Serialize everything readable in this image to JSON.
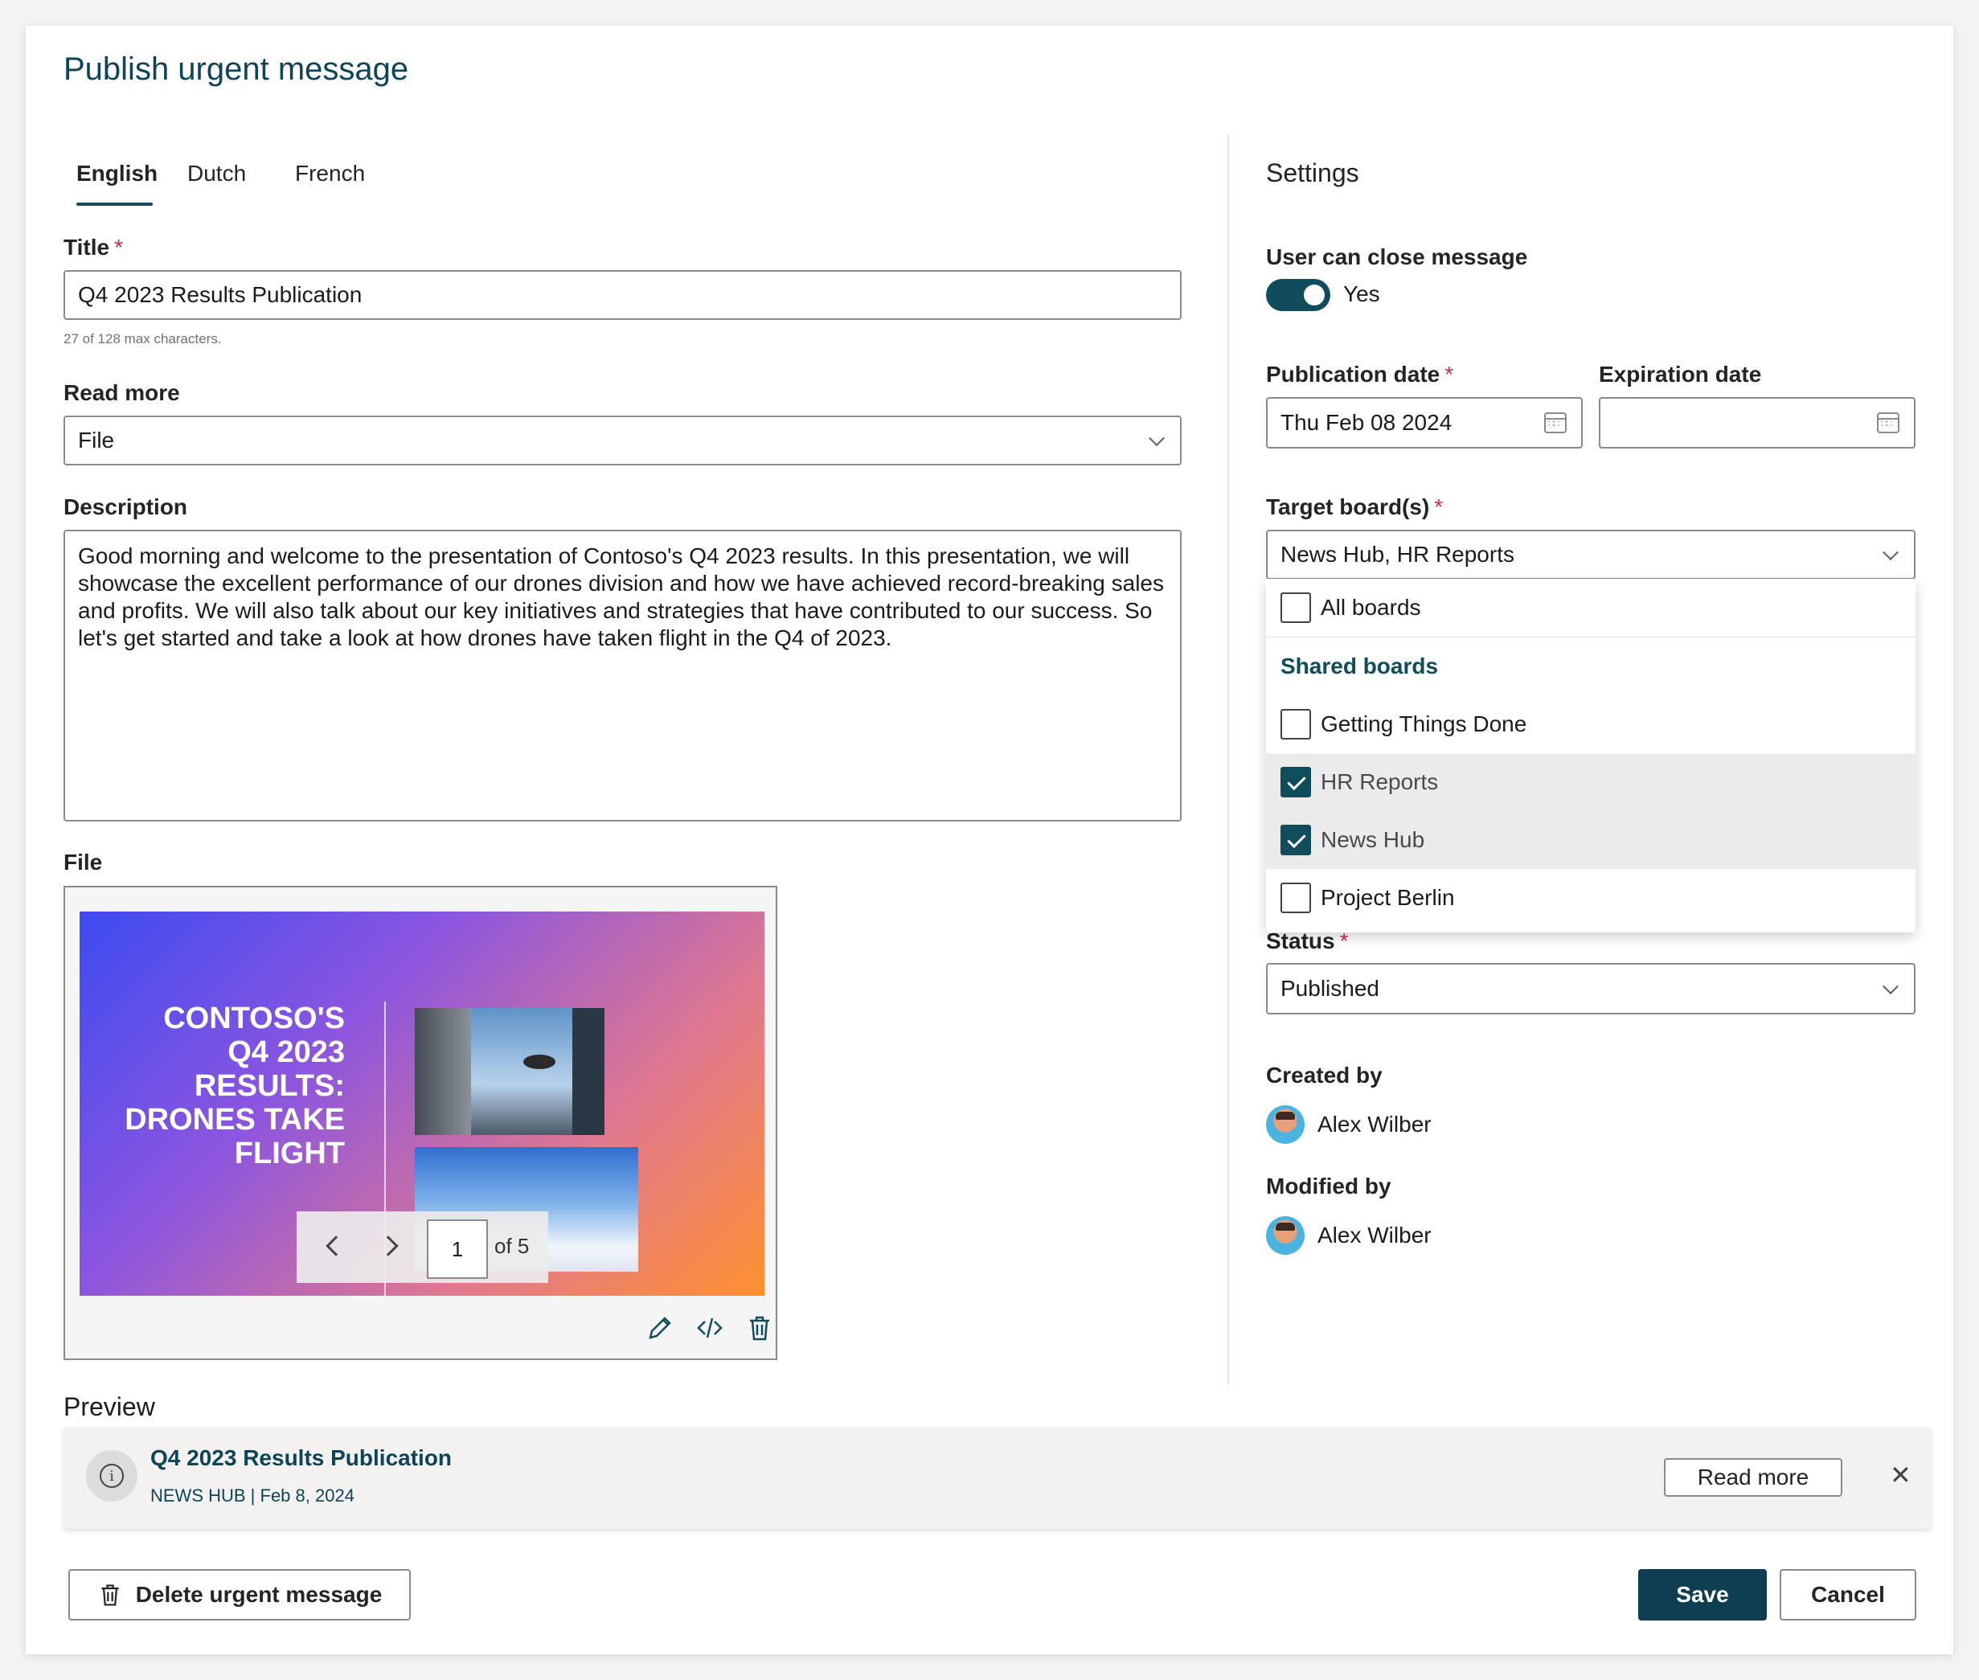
{
  "dialog": {
    "title": "Publish urgent message"
  },
  "tabs": [
    {
      "label": "English",
      "active": true
    },
    {
      "label": "Dutch",
      "active": false
    },
    {
      "label": "French",
      "active": false
    }
  ],
  "form": {
    "title_label": "Title",
    "title_value": "Q4 2023 Results Publication",
    "title_hint": "27 of 128 max characters.",
    "read_more_label": "Read more",
    "read_more_value": "File",
    "description_label": "Description",
    "description_value": "Good morning and welcome to the presentation of Contoso's Q4 2023 results. In this presentation, we will showcase the excellent performance of our drones division and how we have achieved record-breaking sales and profits. We will also talk about our key initiatives and strategies that have contributed to our success. So let's get started and take a look at how drones have taken flight in the Q4 of 2023.",
    "file_label": "File",
    "required_mark": "*"
  },
  "file_preview": {
    "slide_title_lines": [
      "CONTOSO'S",
      "Q4 2023",
      "RESULTS:",
      "DRONES TAKE",
      "FLIGHT"
    ],
    "page_current": "1",
    "page_total": "of 5",
    "tool_icons": [
      "pencil-icon",
      "code-icon",
      "trash-icon"
    ]
  },
  "settings": {
    "heading": "Settings",
    "user_can_close_label": "User can close message",
    "user_can_close_value": "Yes",
    "publication_date_label": "Publication date",
    "publication_date_value": "Thu Feb 08 2024",
    "expiration_date_label": "Expiration date",
    "expiration_date_value": "",
    "target_boards_label": "Target board(s)",
    "target_boards_value": "News Hub, HR Reports",
    "dropdown": {
      "all_boards": {
        "label": "All boards",
        "checked": false
      },
      "group_label": "Shared boards",
      "options": [
        {
          "label": "Getting Things Done",
          "checked": false
        },
        {
          "label": "HR Reports",
          "checked": true
        },
        {
          "label": "News Hub",
          "checked": true
        },
        {
          "label": "Project Berlin",
          "checked": false
        }
      ]
    },
    "status_label": "Status",
    "status_value": "Published",
    "created_by_label": "Created by",
    "created_by_name": "Alex Wilber",
    "modified_by_label": "Modified by",
    "modified_by_name": "Alex Wilber"
  },
  "preview": {
    "label": "Preview",
    "message_title": "Q4 2023 Results Publication",
    "message_meta": "NEWS HUB | Feb 8, 2024",
    "read_more_button": "Read more",
    "info_icon_glyph": "i",
    "close_glyph": "✕"
  },
  "footer": {
    "delete_button": "Delete urgent message",
    "save_button": "Save",
    "cancel_button": "Cancel"
  },
  "colors": {
    "accent": "#0f4c5c",
    "title": "#0d4457",
    "required": "#c4314b",
    "primary_button": "#0f3d52"
  }
}
